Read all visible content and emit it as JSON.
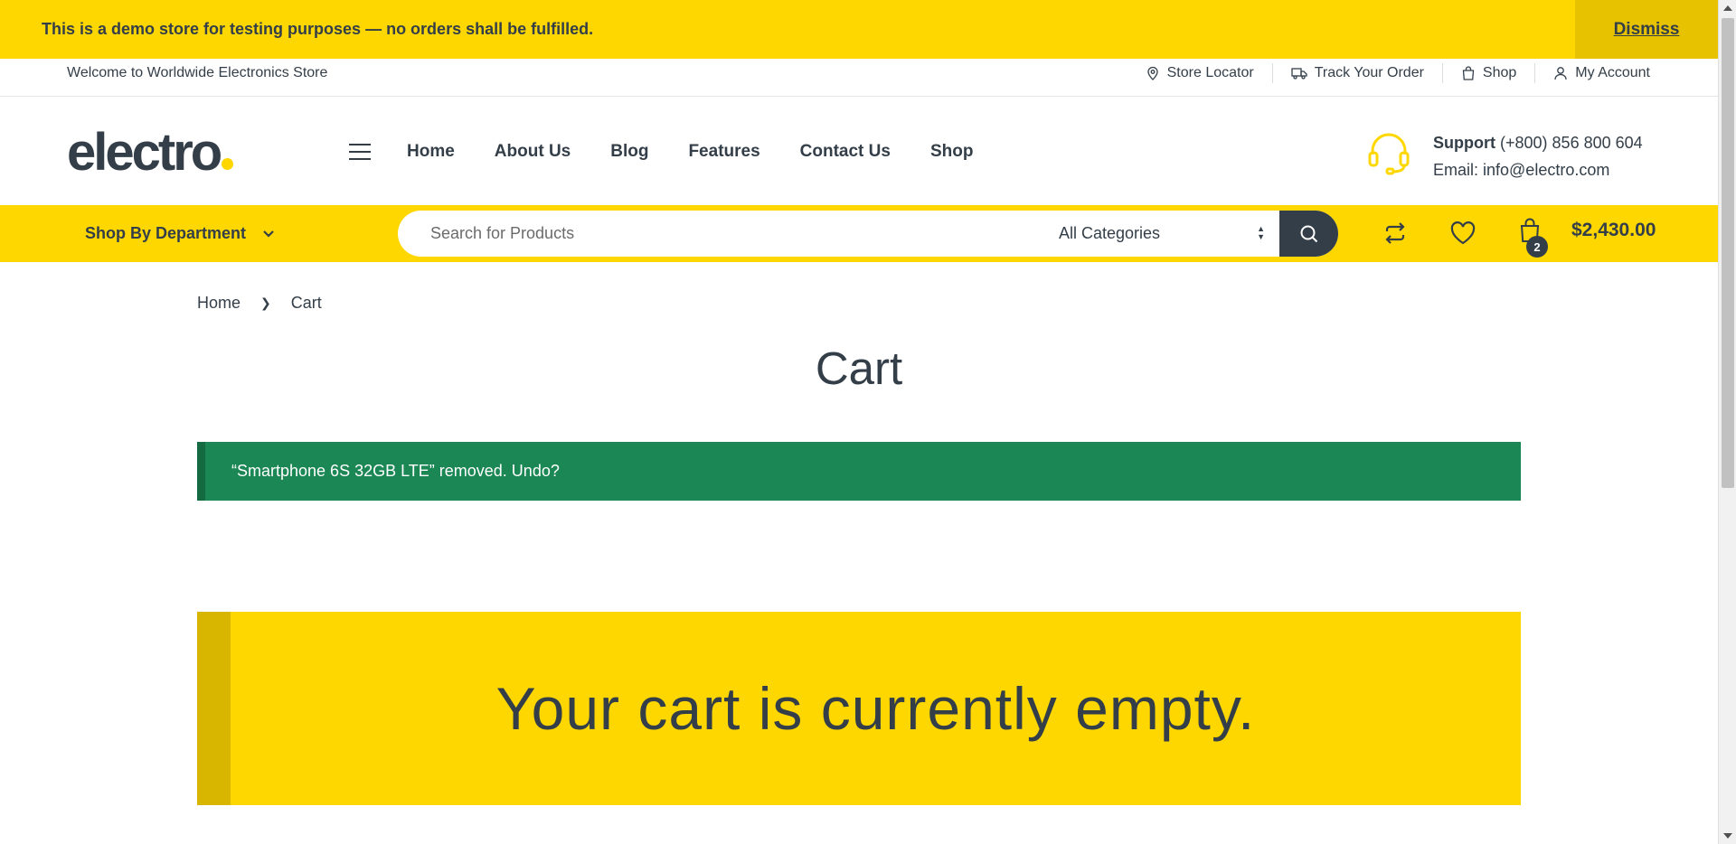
{
  "demo_notice": {
    "text": "This is a demo store for testing purposes — no orders shall be fulfilled.",
    "dismiss_label": "Dismiss"
  },
  "topbar": {
    "welcome": "Welcome to Worldwide Electronics Store",
    "links": [
      {
        "label": "Store Locator",
        "icon": "map-pin-icon"
      },
      {
        "label": "Track Your Order",
        "icon": "truck-icon"
      },
      {
        "label": "Shop",
        "icon": "shopping-bag-icon"
      },
      {
        "label": "My Account",
        "icon": "user-icon"
      }
    ]
  },
  "header": {
    "logo": "electro",
    "nav": [
      "Home",
      "About Us",
      "Blog",
      "Features",
      "Contact Us",
      "Shop"
    ],
    "support_label": "Support",
    "support_phone": "(+800) 856 800 604",
    "support_email": "Email: info@electro.com"
  },
  "navbar": {
    "department_label": "Shop By Department",
    "search_placeholder": "Search for Products",
    "category_selected": "All Categories",
    "cart_count": "2",
    "cart_total": "$2,430.00"
  },
  "breadcrumb": {
    "home": "Home",
    "current": "Cart"
  },
  "page": {
    "title": "Cart",
    "notice": "“Smartphone 6S 32GB LTE” removed. Undo?",
    "empty_message": "Your cart is currently empty."
  },
  "colors": {
    "accent": "#fed700",
    "dark": "#333e48",
    "success": "#1b8754"
  }
}
